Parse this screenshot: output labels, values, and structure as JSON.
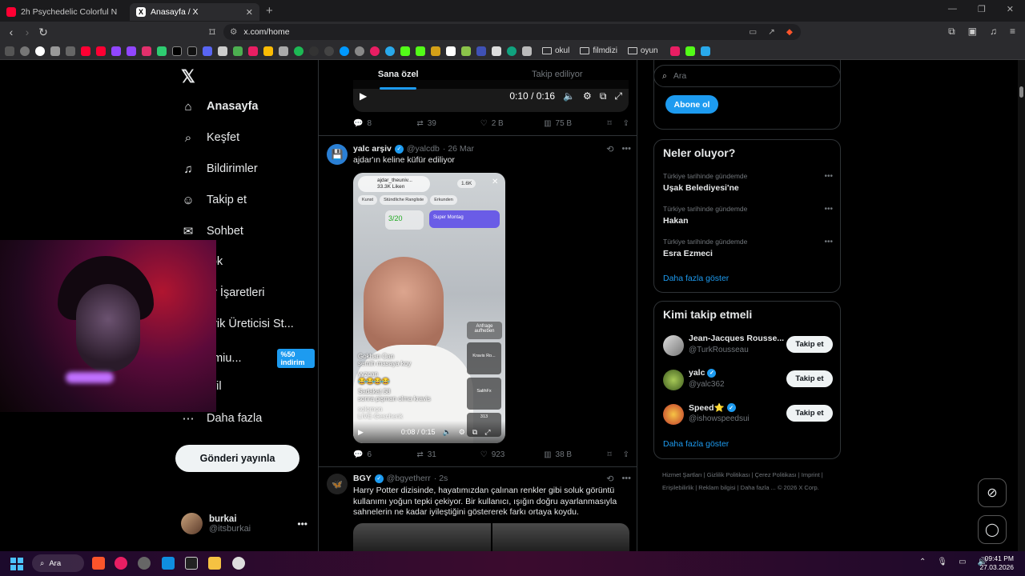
{
  "browser": {
    "tabs": [
      {
        "label": "2h Psychedelic Colorful Neon Backg",
        "icon": "youtube-icon",
        "color": "#ff0033"
      },
      {
        "label": "Anasayfa / X",
        "icon": "x-icon",
        "color": "#000000"
      }
    ],
    "url": "x.com/home",
    "bookmark_folders": [
      "okul",
      "filmdizi",
      "oyun"
    ]
  },
  "sidebar": {
    "items": [
      {
        "label": "Anasayfa",
        "icon": "home-icon"
      },
      {
        "label": "Keşfet",
        "icon": "search-icon"
      },
      {
        "label": "Bildirimler",
        "icon": "bell-icon"
      },
      {
        "label": "Takip et",
        "icon": "person-add-icon"
      },
      {
        "label": "Sohbet",
        "icon": "mail-icon"
      },
      {
        "label": "rok",
        "icon": "grok-icon"
      },
      {
        "label": "er İşaretleri",
        "icon": "bookmark-icon"
      },
      {
        "label": "erik Üreticisi St...",
        "icon": "creator-icon"
      },
      {
        "label": "emiu...",
        "icon": "premium-icon"
      },
      {
        "label": "ofil",
        "icon": "profile-icon"
      },
      {
        "label": "Daha fazla",
        "icon": "more-icon"
      }
    ],
    "premium_badge": "%50 indirim",
    "post_button": "Gönderi yayınla",
    "user": {
      "name": "burkai",
      "handle": "@itsburkai"
    }
  },
  "feed": {
    "tabs": [
      "Sana özel",
      "Takip ediliyor"
    ],
    "top_video_time": "0:10 / 0:16",
    "top_post_stats": {
      "replies": "8",
      "reposts": "39",
      "likes": "2 B",
      "views": "75 B"
    },
    "posts": [
      {
        "name": "yalc arşiv",
        "handle": "@yalcdb",
        "date": "· 26 Mar",
        "text": "ajdar'ın keline küfür ediliyor",
        "video": {
          "account": "ajdar_theuniv...",
          "likes": "33.3K Liken",
          "viewers": "1.6K",
          "chips": [
            "Kunst",
            "Stündliche Rangliste",
            "Erkunden"
          ],
          "rank": "3/20",
          "super": "Super Montag",
          "anfrage": "Anfrage aufheben",
          "side_users": [
            "Kravis Ro...",
            "SalihFx",
            "313"
          ],
          "comments": [
            "Gokhan Can",
            "semih masaya koy",
            "yyzcan",
            "😂😂😂😂",
            "Sadakat.58",
            "sonra pişman olma kravis",
            "solomon",
            "LIVE-Geschenk"
          ],
          "time": "0:08 / 0:15"
        },
        "stats": {
          "replies": "6",
          "reposts": "31",
          "likes": "923",
          "views": "38 B"
        }
      },
      {
        "name": "BGY",
        "handle": "@bgyetherr",
        "date": "· 2s",
        "text": "Harry Potter dizisinde, hayatımızdan çalınan renkler gibi soluk görüntü kullanımı yoğun tepki çekiyor. Bir kullanıcı, ışığın doğru ayarlanmasıyla sahnelerin ne kadar iyileştiğini göstererek farkı ortaya koydu."
      }
    ]
  },
  "right": {
    "search_placeholder": "Ara",
    "subscribe_label": "Abone ol",
    "trends_title": "Neler oluyor?",
    "trends": [
      {
        "category": "Türkiye tarihinde gündemde",
        "name": "Uşak Belediyesi'ne"
      },
      {
        "category": "Türkiye tarihinde gündemde",
        "name": "Hakan"
      },
      {
        "category": "Türkiye tarihinde gündemde",
        "name": "Esra Ezmeci"
      }
    ],
    "show_more": "Daha fazla göster",
    "who_title": "Kimi takip etmeli",
    "who": [
      {
        "name": "Jean-Jacques Rousse...",
        "handle": "@TurkRousseau",
        "verified": false
      },
      {
        "name": "yalc",
        "handle": "@yalc362",
        "verified": true
      },
      {
        "name": "Speed⭐",
        "handle": "@ishowspeedsui",
        "verified": true
      }
    ],
    "follow_label": "Takip et",
    "footer": "Hizmet Şartları  |  Gizlilik Politikası  |  Çerez Politikası  |  Imprint  |  Erişilebilirlik  |  Reklam bilgisi  |  Daha fazla ...  © 2026 X Corp."
  },
  "taskbar": {
    "search": "Ara",
    "time": "09:41 PM",
    "date": "27.03.2026"
  },
  "colors": {
    "accent": "#1d9bf0",
    "background": "#000000",
    "border": "#2f3336",
    "muted": "#71767b"
  }
}
